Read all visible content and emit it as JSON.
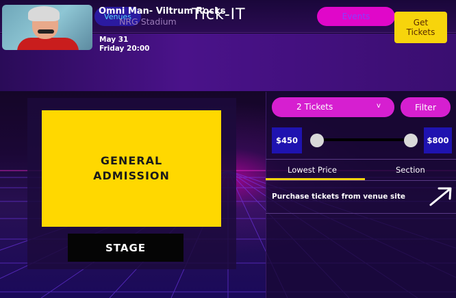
{
  "header": {
    "title": "Tick-IT",
    "venues_label": "Venues",
    "events_label": "Events"
  },
  "event": {
    "name": "Omni Man- Viltrum Rocks",
    "venue": "NRG Stadium",
    "date_line1": "May 31",
    "date_line2": "Friday 20:00",
    "get_tickets_label": "Get\nTickets"
  },
  "map": {
    "general_admission": "GENERAL\nADMISSION",
    "stage": "STAGE"
  },
  "filters": {
    "tickets_selected": "2 Tickets",
    "tickets_chevron": "v",
    "filter_label": "Filter",
    "price_min": "$450",
    "price_max": "$800"
  },
  "tabs": {
    "lowest_price": "Lowest Price",
    "section": "Section",
    "active": "lowest_price"
  },
  "listing": {
    "purchase_text": "Purchase tickets from venue site"
  },
  "colors": {
    "accent_pink": "#d61fd0",
    "accent_yellow": "#f7d40c",
    "price_box_blue": "#1f13b0",
    "background": "#14062a"
  },
  "icons": {
    "external": "arrow-up-right-icon"
  }
}
